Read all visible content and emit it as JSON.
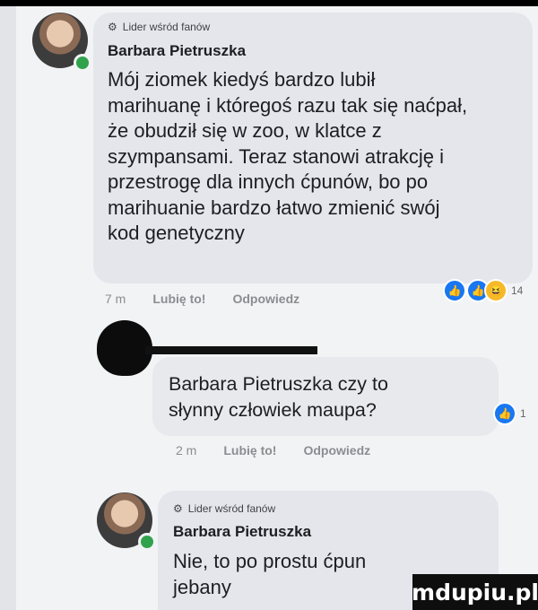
{
  "comments": [
    {
      "badge": "Lider wśród fanów",
      "author": "Barbara Pietruszka",
      "text": "Mój ziomek kiedyś bardzo lubił\nmarihuanę i któregoś razu tak się naćpał,\nże obudził się w zoo, w klatce z\nszympansami. Teraz stanowi atrakcję i\nprzestrogę dla innych ćpunów, bo po\nmarihuanie bardzo łatwo zmienić swój\nkod genetyczny",
      "time": "7 m",
      "like": "Lubię to!",
      "reply": "Odpowiedz",
      "reaction_count": "14"
    },
    {
      "text": "Barbara Pietruszka czy to\nsłynny człowiek maupa?",
      "time": "2 m",
      "like": "Lubię to!",
      "reply": "Odpowiedz",
      "reaction_count": "1"
    },
    {
      "badge": "Lider wśród fanów",
      "author": "Barbara Pietruszka",
      "text": "Nie, to po prostu ćpun\njebany"
    }
  ],
  "watermark": "mdupiu.pl",
  "icons": {
    "badge": "fan-badge-icon",
    "like": "like-reaction-icon",
    "haha": "haha-reaction-icon"
  },
  "colors": {
    "like_reaction": "#1877f2",
    "haha_reaction": "#f7b928",
    "online": "#31a24c",
    "bubble": "#e4e6eb"
  }
}
